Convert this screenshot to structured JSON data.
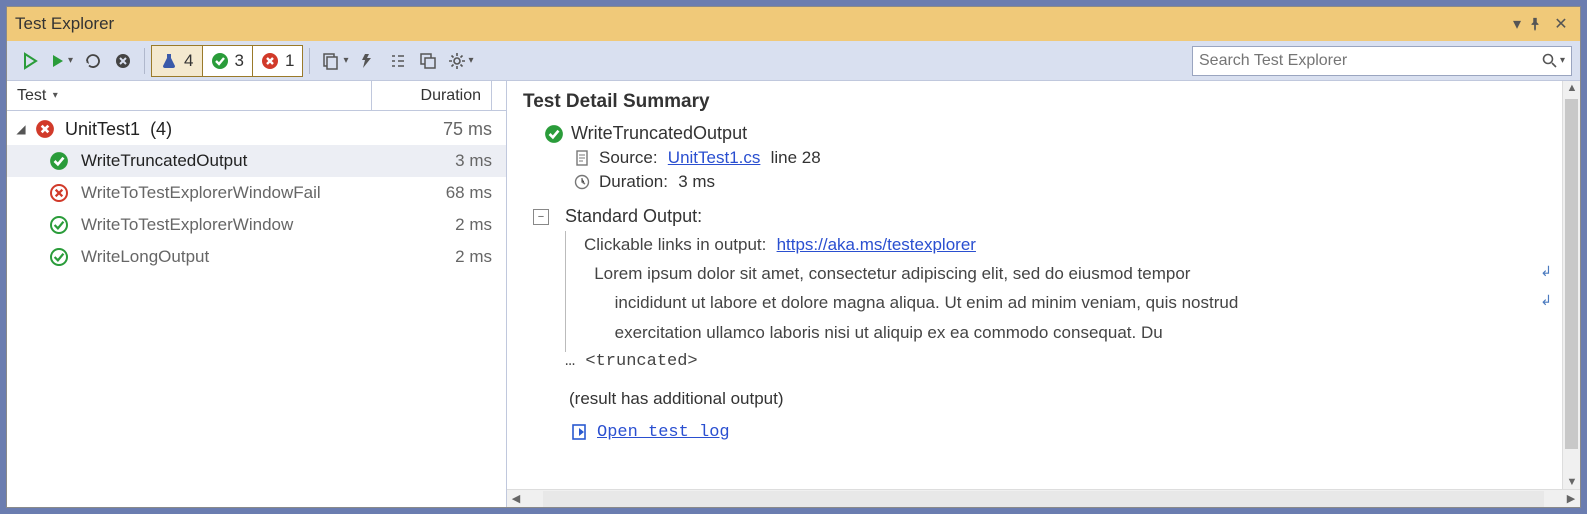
{
  "title": "Test Explorer",
  "search": {
    "placeholder": "Search Test Explorer"
  },
  "filters": {
    "total": "4",
    "passed": "3",
    "failed": "1"
  },
  "columns": {
    "test": "Test",
    "duration": "Duration"
  },
  "tree": {
    "group": {
      "name": "UnitTest1",
      "count": "(4)",
      "duration": "75 ms"
    },
    "items": [
      {
        "name": "WriteTruncatedOutput",
        "duration": "3 ms",
        "status": "pass-solid",
        "selected": true
      },
      {
        "name": "WriteToTestExplorerWindowFail",
        "duration": "68 ms",
        "status": "fail-outline",
        "selected": false
      },
      {
        "name": "WriteToTestExplorerWindow",
        "duration": "2 ms",
        "status": "pass-outline",
        "selected": false
      },
      {
        "name": "WriteLongOutput",
        "duration": "2 ms",
        "status": "pass-outline",
        "selected": false
      }
    ]
  },
  "detail": {
    "heading": "Test Detail Summary",
    "testName": "WriteTruncatedOutput",
    "sourceLabel": "Source:",
    "sourceFile": "UnitTest1.cs",
    "sourceLine": "line 28",
    "durationLabel": "Duration:",
    "durationValue": "3 ms",
    "stdoutLabel": "Standard Output:",
    "stdoutLinksLabel": "Clickable links in output:",
    "stdoutLink": "https://aka.ms/testexplorer",
    "lorem1": "Lorem ipsum dolor sit amet, consectetur adipiscing elit, sed do eiusmod tempor",
    "lorem2": "incididunt ut labore et dolore magna aliqua. Ut enim ad minim veniam, quis nostrud",
    "lorem3": "exercitation ullamco laboris nisi ut aliquip ex ea commodo consequat. Du",
    "truncated": "… <truncated>",
    "additional": "(result has additional output)",
    "openLog": "Open test log"
  }
}
